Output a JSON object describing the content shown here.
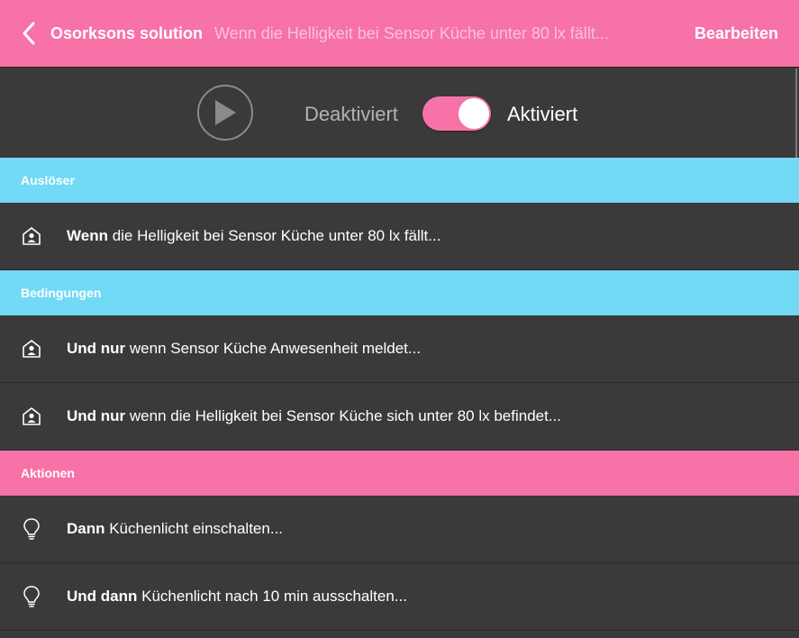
{
  "header": {
    "title": "Osorksons solution",
    "subtitle": "Wenn die Helligkeit bei Sensor Küche unter 80 lx fällt...",
    "edit_label": "Bearbeiten"
  },
  "controls": {
    "label_off": "Deaktiviert",
    "label_on": "Aktiviert",
    "enabled": true
  },
  "sections": {
    "trigger": {
      "title": "Auslöser",
      "items": [
        {
          "icon": "home-person-icon",
          "bold": "Wenn",
          "text": " die Helligkeit bei Sensor Küche unter 80 lx fällt..."
        }
      ]
    },
    "conditions": {
      "title": "Bedingungen",
      "items": [
        {
          "icon": "home-person-icon",
          "bold": "Und nur",
          "text": " wenn Sensor Küche Anwesenheit meldet..."
        },
        {
          "icon": "home-person-icon",
          "bold": "Und nur",
          "text": " wenn die Helligkeit bei Sensor Küche sich unter 80 lx befindet..."
        }
      ]
    },
    "actions": {
      "title": "Aktionen",
      "items": [
        {
          "icon": "lightbulb-icon",
          "bold": "Dann",
          "text": " Küchenlicht einschalten..."
        },
        {
          "icon": "lightbulb-icon",
          "bold": "Und dann",
          "text": " Küchenlicht nach 10 min ausschalten..."
        }
      ]
    }
  },
  "colors": {
    "accent_pink": "#f772a7",
    "accent_blue": "#72d9f7",
    "background": "#3a3a3a"
  }
}
